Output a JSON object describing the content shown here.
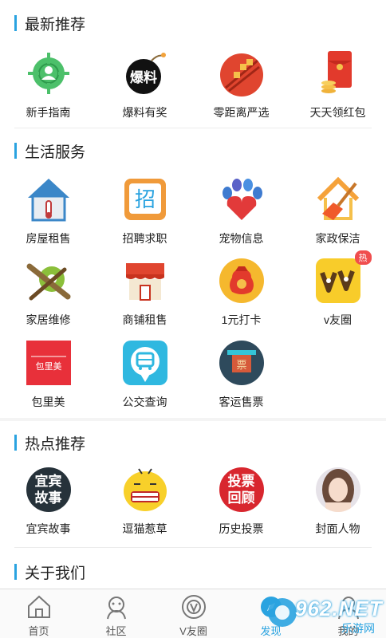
{
  "sections": {
    "latest": {
      "title": "最新推荐",
      "items": [
        {
          "label": "新手指南",
          "icon": "guide-icon"
        },
        {
          "label": "爆料有奖",
          "icon": "bomb-icon",
          "icon_text": "爆料"
        },
        {
          "label": "零距离严选",
          "icon": "skewer-icon"
        },
        {
          "label": "天天领红包",
          "icon": "red-envelope-icon"
        }
      ]
    },
    "life": {
      "title": "生活服务",
      "items": [
        {
          "label": "房屋租售",
          "icon": "house-icon"
        },
        {
          "label": "招聘求职",
          "icon": "recruit-icon",
          "icon_text": "招"
        },
        {
          "label": "宠物信息",
          "icon": "paw-icon"
        },
        {
          "label": "家政保洁",
          "icon": "broom-icon"
        },
        {
          "label": "家居维修",
          "icon": "wrench-icon"
        },
        {
          "label": "商铺租售",
          "icon": "shop-icon"
        },
        {
          "label": "1元打卡",
          "icon": "money-bag-icon"
        },
        {
          "label": "v友圈",
          "icon": "vv-icon",
          "badge": "热"
        },
        {
          "label": "包里美",
          "icon": "baolimei-logo",
          "icon_text": "包里美"
        },
        {
          "label": "公交查询",
          "icon": "bus-icon"
        },
        {
          "label": "客运售票",
          "icon": "ticket-icon",
          "icon_text": "票"
        }
      ]
    },
    "hot": {
      "title": "热点推荐",
      "items": [
        {
          "label": "宜宾故事",
          "icon": "story-icon",
          "icon_text": "宜宾故事"
        },
        {
          "label": "逗猫惹草",
          "icon": "funny-face-icon"
        },
        {
          "label": "历史投票",
          "icon": "vote-icon",
          "icon_text": "投票回顾"
        },
        {
          "label": "封面人物",
          "icon": "cover-person-icon"
        }
      ]
    },
    "about": {
      "title": "关于我们"
    }
  },
  "tabbar": [
    {
      "label": "首页",
      "icon": "home-icon"
    },
    {
      "label": "社区",
      "icon": "community-icon"
    },
    {
      "label": "V友圈",
      "icon": "vcircle-icon"
    },
    {
      "label": "发现",
      "icon": "discover-icon",
      "active": true
    },
    {
      "label": "我的",
      "icon": "profile-icon"
    }
  ],
  "watermark": {
    "text": "962.NET",
    "subtext": "乐游网"
  },
  "colors": {
    "accent": "#2aa3e0"
  }
}
